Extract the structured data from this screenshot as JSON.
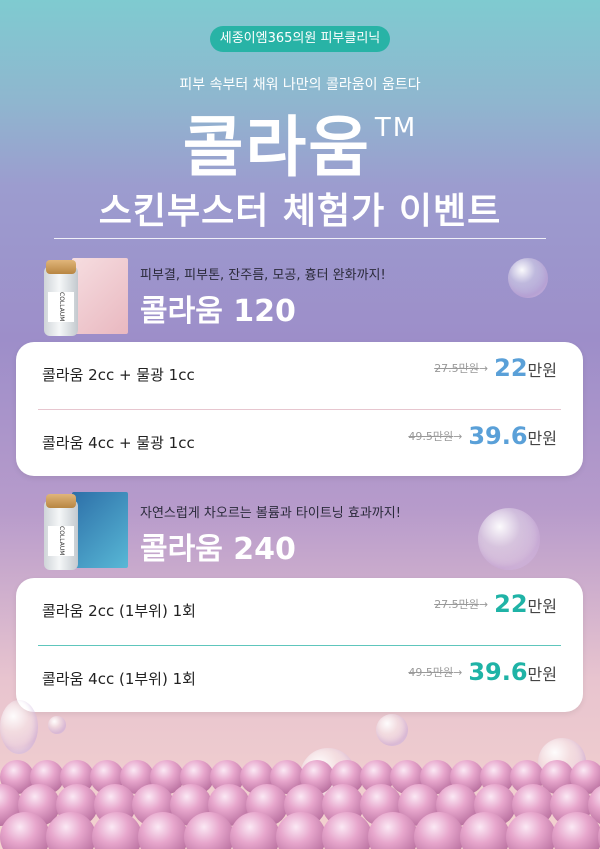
{
  "header": {
    "clinic": "세종이엠365의원 피부클리닉",
    "tagline": "피부 속부터 채워 나만의 콜라움이 움트다",
    "brand": "콜라움",
    "trademark": "TM",
    "title": "스킨부스터 체험가 이벤트"
  },
  "products": [
    {
      "subtitle": "피부결, 피부톤, 잔주름, 모공, 흉터 완화까지!",
      "name": "콜라움 120",
      "vial_label": "COLLAUM",
      "box_color": "#f3d6d9",
      "accent": "#5aa0d8",
      "divider": "#e7c6cf",
      "options": [
        {
          "label": "콜라움 2cc + 물광 1cc",
          "old_price": "27.5만원",
          "arrow": "→",
          "price": "22",
          "unit": "만원"
        },
        {
          "label": "콜라움 4cc + 물광 1cc",
          "old_price": "49.5만원",
          "arrow": "→",
          "price": "39.6",
          "unit": "만원"
        }
      ]
    },
    {
      "subtitle": "자연스럽게 차오르는 볼륨과 타이트닝 효과까지!",
      "name": "콜라움 240",
      "vial_label": "COLLAUM",
      "box_color": "#3d8fc0",
      "accent": "#1fb3a6",
      "divider": "#5ec6bc",
      "options": [
        {
          "label": "콜라움 2cc (1부위) 1회",
          "old_price": "27.5만원",
          "arrow": "→",
          "price": "22",
          "unit": "만원"
        },
        {
          "label": "콜라움 4cc (1부위) 1회",
          "old_price": "49.5만원",
          "arrow": "→",
          "price": "39.6",
          "unit": "만원"
        }
      ]
    }
  ]
}
